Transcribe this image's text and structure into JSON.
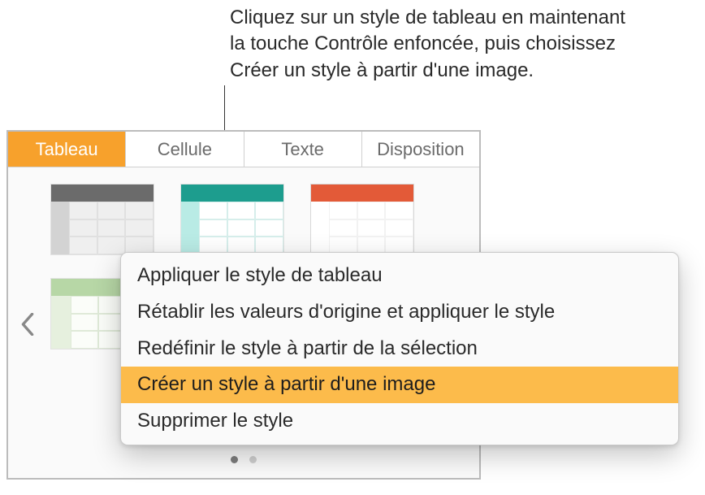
{
  "callout": {
    "text": "Cliquez sur un style de tableau en maintenant la touche Contrôle enfoncée, puis choisissez Créer un style à partir d'une image."
  },
  "tabs": {
    "tableau": "Tableau",
    "cellule": "Cellule",
    "texte": "Texte",
    "disposition": "Disposition"
  },
  "menu": {
    "apply": "Appliquer le style de tableau",
    "reset": "Rétablir les valeurs d'origine et appliquer le style",
    "redefine": "Redéfinir le style à partir de la sélection",
    "createFromImage": "Créer un style à partir d'une image",
    "delete": "Supprimer le style"
  },
  "colors": {
    "accent": "#f7a12c",
    "highlight": "#fcbb4b"
  }
}
